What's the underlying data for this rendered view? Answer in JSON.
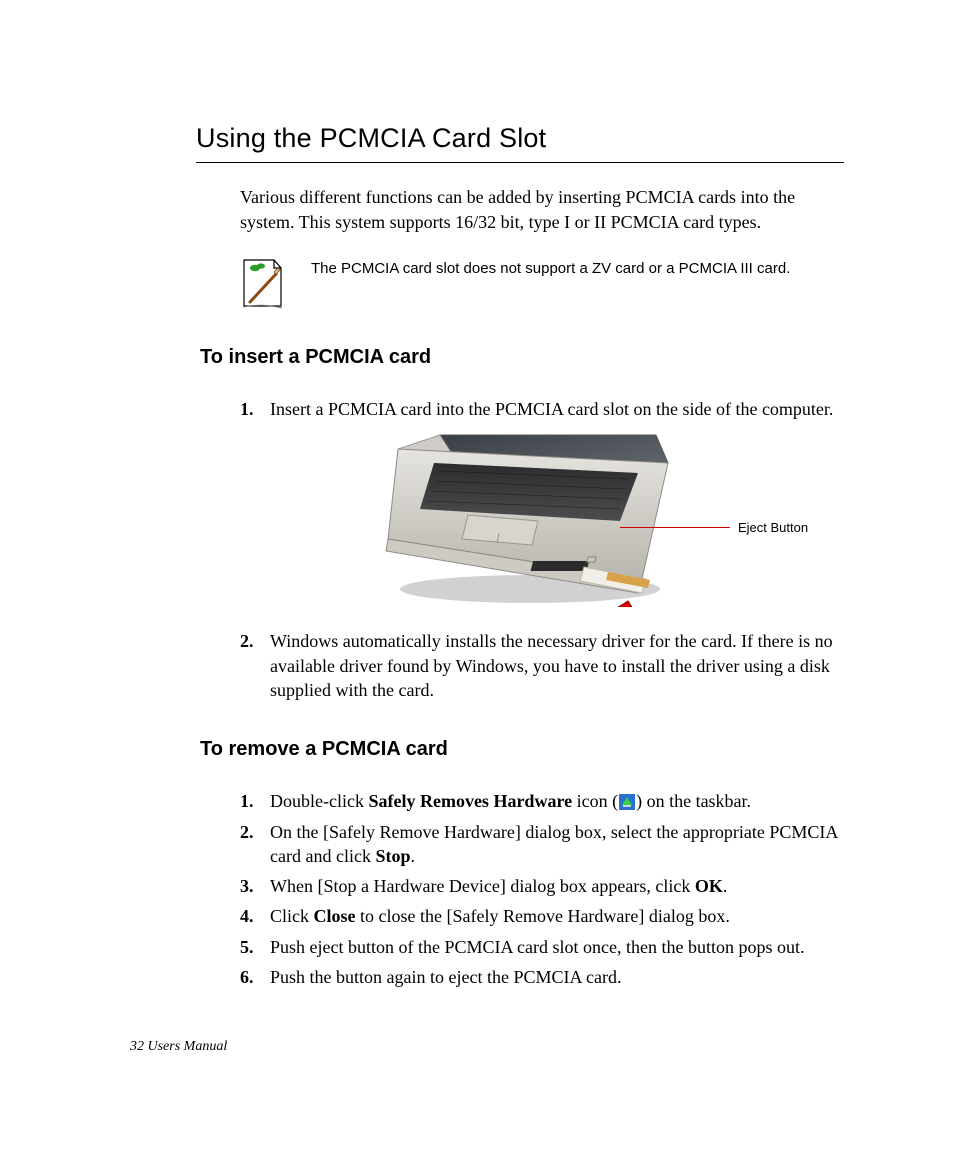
{
  "title": "Using the PCMCIA Card Slot",
  "intro": "Various different functions can be added by inserting PCMCIA cards into the system. This system supports 16/32 bit, type I or II PCMCIA card types.",
  "note": "The PCMCIA card slot does not support a ZV card or a PCMCIA III card.",
  "section_insert": {
    "heading": "To insert a PCMCIA card",
    "steps": [
      "Insert a PCMCIA card into the PCMCIA card slot on the side of the computer.",
      "Windows automatically installs the necessary driver for the card. If there is no available driver found by Windows, you have to install the driver using a disk supplied with the card."
    ],
    "callout": "Eject Button"
  },
  "section_remove": {
    "heading": "To remove a PCMCIA card",
    "steps": {
      "s1a": "Double-click ",
      "s1b": "Safely Removes Hardware",
      "s1c": " icon (",
      "s1d": ") on the taskbar.",
      "s2a": "On the [Safely Remove Hardware] dialog box, select the appropriate PCMCIA card and click ",
      "s2b": "Stop",
      "s2c": ".",
      "s3a": "When [Stop a Hardware Device] dialog box appears, click ",
      "s3b": "OK",
      "s3c": ".",
      "s4a": "Click ",
      "s4b": "Close",
      "s4c": " to close the [Safely Remove Hardware] dialog box.",
      "s5": "Push eject button of the PCMCIA card slot once, then the button pops out.",
      "s6": "Push the button again to eject the PCMCIA card."
    }
  },
  "footer": "32  Users Manual",
  "numbers": [
    "1.",
    "2.",
    "3.",
    "4.",
    "5.",
    "6."
  ]
}
